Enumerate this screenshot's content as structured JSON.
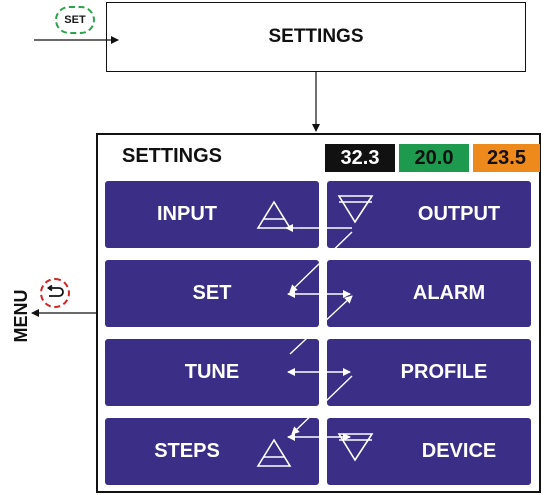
{
  "flow": {
    "set_key_label": "SET",
    "settings_title": "SETTINGS"
  },
  "screen": {
    "title": "SETTINGS",
    "readings": [
      {
        "value": "32.3",
        "bg": "#111111",
        "fg": "#ffffff"
      },
      {
        "value": "20.0",
        "bg": "#1e9a4f",
        "fg": "#111111"
      },
      {
        "value": "23.5",
        "bg": "#ee8a1c",
        "fg": "#111111"
      }
    ],
    "menu_items": [
      {
        "label": "INPUT"
      },
      {
        "label": "OUTPUT"
      },
      {
        "label": "SET"
      },
      {
        "label": "ALARM"
      },
      {
        "label": "TUNE"
      },
      {
        "label": "PROFILE"
      },
      {
        "label": "STEPS"
      },
      {
        "label": "DEVICE"
      }
    ]
  },
  "side": {
    "menu_label": "MENU"
  },
  "colors": {
    "tile": "#3a2e86",
    "set_key_border": "#2aa34a",
    "back_key_border": "#d32424"
  }
}
